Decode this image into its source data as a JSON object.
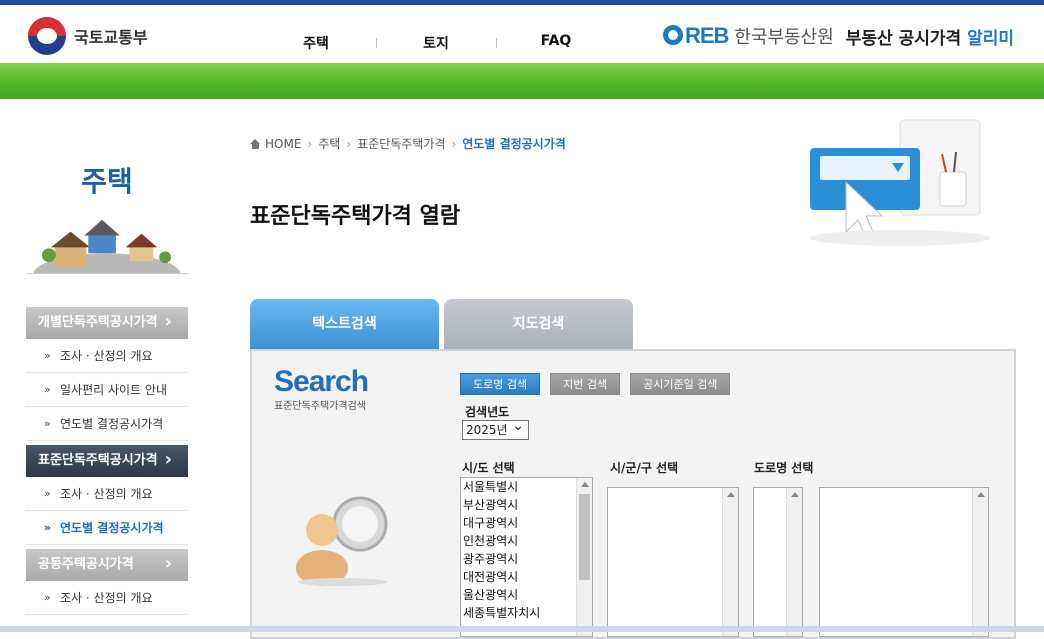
{
  "header": {
    "ministry": "국토교통부",
    "nav": [
      "주택",
      "토지",
      "FAQ"
    ],
    "brand_logo": "REB",
    "brand_org": "한국부동산원",
    "brand_service_prefix": "부동산 공시가격",
    "brand_service_accent": "알리미"
  },
  "sidebar": {
    "title": "주택",
    "menus": [
      {
        "label": "개별단독주택공시가격",
        "items": [
          "조사 · 산정의 개요",
          "일사편리 사이트 안내",
          "연도별 결정공시가격"
        ]
      },
      {
        "label": "표준단독주택공시가격",
        "items": [
          "조사 · 산정의 개요",
          "연도별 결정공시가격"
        ]
      },
      {
        "label": "공동주택공시가격",
        "items": [
          "조사 · 산정의 개요"
        ]
      }
    ]
  },
  "breadcrumb": [
    "HOME",
    "주택",
    "표준단독주택가격",
    "연도별 결정공시가격"
  ],
  "page_title": "표준단독주택가격 열람",
  "tabs": [
    "텍스트검색",
    "지도검색"
  ],
  "search": {
    "logo_word": "Search",
    "logo_sub": "표준단독주택가격검색",
    "buttons": [
      "도로명 검색",
      "지번 검색",
      "공시기준일 검색"
    ],
    "year_label": "검색년도",
    "year_value": "2025년",
    "col_sido": "시/도 선택",
    "col_sigungu": "시/군/구 선택",
    "col_road": "도로명 선택",
    "sido_options": [
      "서울특별시",
      "부산광역시",
      "대구광역시",
      "인천광역시",
      "광주광역시",
      "대전광역시",
      "울산광역시",
      "세종특별자치시"
    ]
  },
  "colors": {
    "accent": "#1e6fc0",
    "green": "#4fb52a",
    "navy": "#1d4e9e"
  }
}
